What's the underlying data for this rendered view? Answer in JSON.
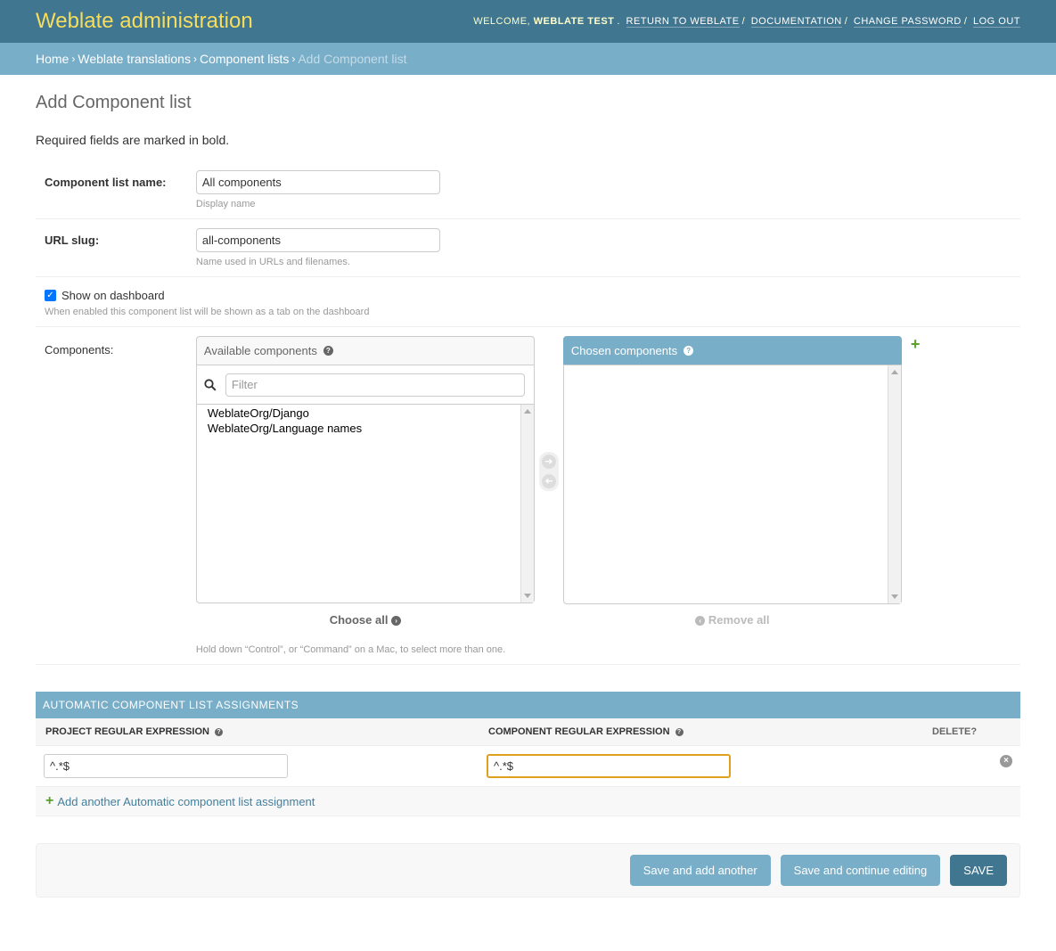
{
  "header": {
    "branding": "Weblate administration",
    "welcome": "Welcome,",
    "user": "Weblate Test",
    "links": [
      "Return to Weblate",
      "Documentation",
      "Change password",
      "Log out"
    ]
  },
  "breadcrumbs": {
    "items": [
      "Home",
      "Weblate translations",
      "Component lists"
    ],
    "current": "Add Component list"
  },
  "page": {
    "title": "Add Component list",
    "required_note": "Required fields are marked in bold."
  },
  "form": {
    "name": {
      "label": "Component list name:",
      "value": "All components",
      "help": "Display name"
    },
    "slug": {
      "label": "URL slug:",
      "value": "all-components",
      "help": "Name used in URLs and filenames."
    },
    "show_dashboard": {
      "label": "Show on dashboard",
      "checked": true,
      "help": "When enabled this component list will be shown as a tab on the dashboard"
    },
    "components": {
      "label": "Components:",
      "available_title": "Available components",
      "chosen_title": "Chosen components",
      "filter_placeholder": "Filter",
      "available_items": [
        "WeblateOrg/Django",
        "WeblateOrg/Language names"
      ],
      "choose_all": "Choose all",
      "remove_all": "Remove all",
      "help": "Hold down “Control”, or “Command” on a Mac, to select more than one."
    }
  },
  "inline": {
    "title": "Automatic component list assignments",
    "columns": [
      "Project regular expression",
      "Component regular expression",
      "Delete?"
    ],
    "rows": [
      {
        "project": "^.*$",
        "component": "^.*$"
      }
    ],
    "add_label": "Add another Automatic component list assignment"
  },
  "buttons": {
    "save_add": "Save and add another",
    "save_continue": "Save and continue editing",
    "save": "Save"
  }
}
